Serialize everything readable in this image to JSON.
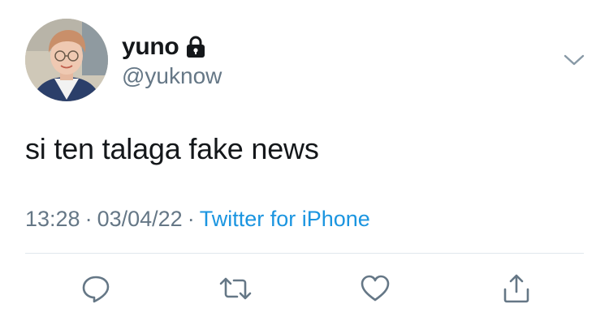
{
  "tweet": {
    "display_name": "yuno",
    "handle": "@yuknow",
    "text": "si ten talaga fake news",
    "time": "13:28",
    "date": "03/04/22",
    "separator": "·",
    "source": "Twitter for iPhone"
  },
  "icons": {
    "lock": "lock-icon",
    "more": "chevron-down-icon",
    "reply": "reply-icon",
    "retweet": "retweet-icon",
    "like": "heart-icon",
    "share": "share-icon"
  },
  "colors": {
    "text_primary": "#14171a",
    "text_secondary": "#657786",
    "link": "#1b95e0",
    "divider": "#e1e8ed"
  }
}
